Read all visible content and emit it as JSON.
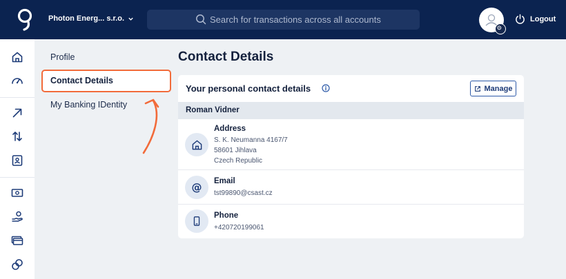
{
  "header": {
    "account_name": "Photon Energ... s.r.o.",
    "search_placeholder": "Search for transactions across all accounts",
    "logout_label": "Logout"
  },
  "subnav": {
    "items": [
      {
        "label": "Profile"
      },
      {
        "label": "Contact Details"
      },
      {
        "label": "My Banking IDentity"
      }
    ]
  },
  "main": {
    "title": "Contact Details",
    "card": {
      "title": "Your personal contact details",
      "manage_label": "Manage",
      "person_name": "Roman Vidner",
      "address": {
        "label": "Address",
        "line1": "S. K. Neumanna 4167/7",
        "line2": "58601 Jihlava",
        "line3": "Czech Republic"
      },
      "email": {
        "label": "Email",
        "value": "tst99890@csast.cz"
      },
      "phone": {
        "label": "Phone",
        "value": "+420720199061"
      }
    }
  },
  "icons": [
    "home-icon",
    "speedometer-icon",
    "arrow-up-right-icon",
    "transfer-arrows-icon",
    "id-card-icon",
    "banknote-icon",
    "savings-hand-icon",
    "cards-icon",
    "investment-icon"
  ],
  "colors": {
    "topbar": "#0b2350",
    "accent_highlight": "#f26b3a",
    "primary": "#2d5aa8"
  }
}
